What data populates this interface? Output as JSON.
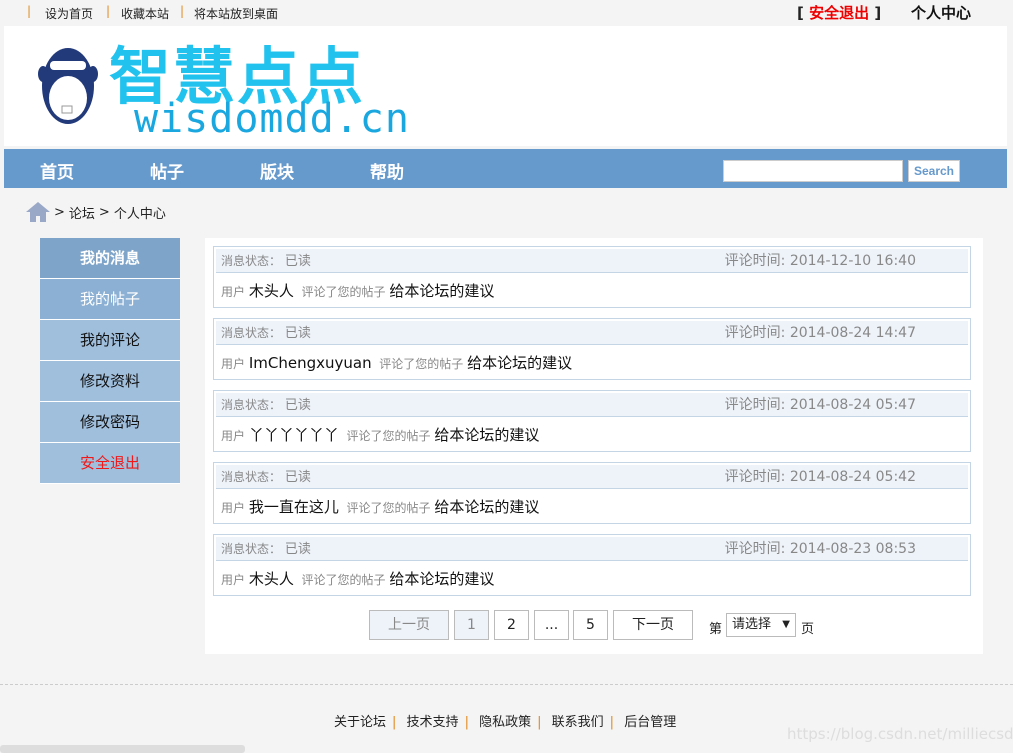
{
  "topbar": {
    "links": [
      "设为首页",
      "收藏本站",
      "将本站放到桌面"
    ],
    "logout": "安全退出",
    "personal": "个人中心"
  },
  "logo": {
    "title": "智慧点点",
    "domain": "wisdomdd.cn"
  },
  "nav": {
    "items": [
      "首页",
      "帖子",
      "版块",
      "帮助"
    ],
    "search_placeholder": "",
    "search_label": "Search"
  },
  "breadcrumb": {
    "items": [
      "论坛",
      "个人中心"
    ],
    "sep": ">"
  },
  "sidebar": {
    "items": [
      "我的消息",
      "我的帖子",
      "我的评论",
      "修改资料",
      "修改密码",
      "安全退出"
    ]
  },
  "messages": [
    {
      "status_label": "消息状态：",
      "status": "已读",
      "time": "评论时间: 2014-12-10 16:40",
      "user_label": "用户",
      "user": "木头人",
      "action": "评论了您的帖子",
      "title": "给本论坛的建议"
    },
    {
      "status_label": "消息状态：",
      "status": "已读",
      "time": "评论时间: 2014-08-24 14:47",
      "user_label": "用户",
      "user": "ImChengxuyuan",
      "action": "评论了您的帖子",
      "title": "给本论坛的建议"
    },
    {
      "status_label": "消息状态：",
      "status": "已读",
      "time": "评论时间: 2014-08-24 05:47",
      "user_label": "用户",
      "user": "丫丫丫丫丫丫",
      "action": "评论了您的帖子",
      "title": "给本论坛的建议"
    },
    {
      "status_label": "消息状态：",
      "status": "已读",
      "time": "评论时间: 2014-08-24 05:42",
      "user_label": "用户",
      "user": "我一直在这儿",
      "action": "评论了您的帖子",
      "title": "给本论坛的建议"
    },
    {
      "status_label": "消息状态：",
      "status": "已读",
      "time": "评论时间: 2014-08-23 08:53",
      "user_label": "用户",
      "user": "木头人",
      "action": "评论了您的帖子",
      "title": "给本论坛的建议"
    }
  ],
  "pagination": {
    "prev": "上一页",
    "pages": [
      "1",
      "2",
      "...",
      "5"
    ],
    "current": "1",
    "next": "下一页",
    "goto_prefix": "第",
    "select_value": "请选择",
    "goto_suffix": "页"
  },
  "footer": {
    "links": [
      "关于论坛",
      "技术支持",
      "隐私政策",
      "联系我们",
      "后台管理"
    ]
  },
  "watermark": "https://blog.csdn.net/milliecsdn",
  "colors": {
    "nav": "#6699cc",
    "logo": "#22c2ee",
    "danger": "#ee0000"
  }
}
